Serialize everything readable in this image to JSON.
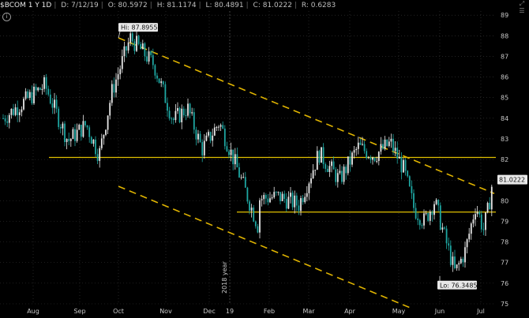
{
  "header": {
    "symbol": "$BCOM 1 Y 1D",
    "date": "D: 7/12/19",
    "open": "O: 80.5972",
    "high": "H: 81.1174",
    "low": "L: 80.4891",
    "close": "C: 81.0222",
    "range": "R: 0.6283"
  },
  "colors": {
    "background": "#000000",
    "candle_up": "#e8e8e8",
    "candle_down": "#1ea7a2",
    "trend_line": "#e0b400",
    "support_line": "#e0c000",
    "grid": "#3a3a3a"
  },
  "chart_data": {
    "type": "candlestick",
    "title": "$BCOM 1 Y 1D",
    "x_ticks": [
      "Aug",
      "Sep",
      "Oct",
      "Nov",
      "Dec",
      "19",
      "Feb",
      "Mar",
      "Apr",
      "May",
      "Jun",
      "Jul"
    ],
    "y_ticks": [
      75,
      76,
      77,
      78,
      79,
      80,
      81,
      82,
      83,
      84,
      85,
      86,
      87,
      88,
      89
    ],
    "ylim": [
      75,
      89.2
    ],
    "year_marker": "2018 year",
    "last_price_label": "81.0222",
    "high_annotation": "Hi: 87.8955",
    "low_annotation": "Lo: 76.3485",
    "horizontal_levels": [
      82.1,
      79.45
    ],
    "trendlines": [
      {
        "name": "upper",
        "from": [
          "Oct",
          87.9
        ],
        "to": [
          "Jul",
          80.4
        ]
      },
      {
        "name": "lower",
        "from": [
          "Oct",
          80.7
        ],
        "to": [
          "May",
          75.0
        ]
      }
    ],
    "close_path": [
      [
        "Jul",
        84.0
      ],
      [
        "Aug",
        85.6
      ],
      [
        "Aug",
        82.9
      ],
      [
        "Sep",
        83.7
      ],
      [
        "Sep",
        82.2
      ],
      [
        "Sep",
        85.3
      ],
      [
        "Oct",
        87.9
      ],
      [
        "Oct",
        86.6
      ],
      [
        "Nov",
        83.9
      ],
      [
        "Nov",
        84.5
      ],
      [
        "Nov",
        82.5
      ],
      [
        "Dec",
        83.8
      ],
      [
        "Dec",
        81.3
      ],
      [
        "Dec",
        78.6
      ],
      [
        "19",
        79.4
      ],
      [
        "Feb",
        80.2
      ],
      [
        "Feb",
        79.8
      ],
      [
        "Mar",
        82.3
      ],
      [
        "Mar",
        81.0
      ],
      [
        "Apr",
        82.6
      ],
      [
        "Apr",
        82.2
      ],
      [
        "Apr",
        82.8
      ],
      [
        "May",
        81.5
      ],
      [
        "May",
        79.6
      ],
      [
        "May",
        79.0
      ],
      [
        "May",
        80.0
      ],
      [
        "Jun",
        78.2
      ],
      [
        "Jun",
        76.5
      ],
      [
        "Jun",
        77.6
      ],
      [
        "Jun",
        79.8
      ],
      [
        "Jul",
        78.6
      ],
      [
        "Jul",
        79.7
      ],
      [
        "Jul",
        81.02
      ]
    ]
  }
}
